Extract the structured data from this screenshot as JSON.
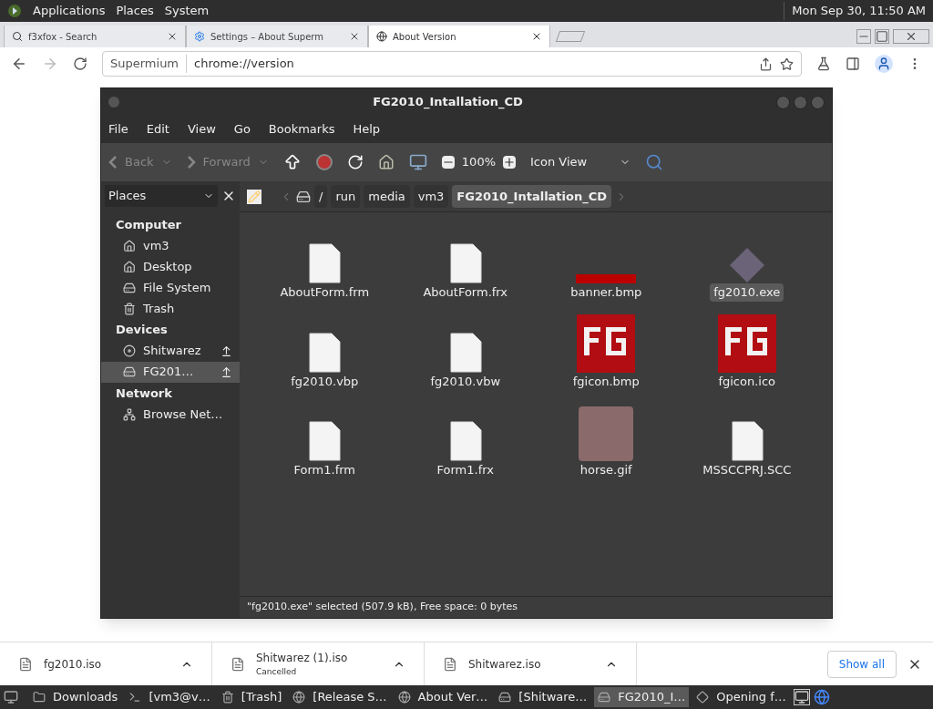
{
  "top_panel": {
    "menus": [
      "Applications",
      "Places",
      "System"
    ],
    "clock": "Mon Sep 30, 11:50 AM"
  },
  "browser": {
    "tabs": [
      {
        "title": "f3xfox - Search",
        "selected": false
      },
      {
        "title": "Settings – About Superm",
        "selected": false
      },
      {
        "title": "About Version",
        "selected": true
      }
    ],
    "address": {
      "site": "Supermium",
      "url": "chrome://version"
    }
  },
  "file_manager": {
    "title": "FG2010_Intallation_CD",
    "menu": [
      "File",
      "Edit",
      "View",
      "Go",
      "Bookmarks",
      "Help"
    ],
    "toolbar": {
      "back": "Back",
      "forward": "Forward",
      "zoom": "100%",
      "view": "Icon View"
    },
    "sidebar": {
      "selector": "Places",
      "sections": [
        {
          "heading": "Computer",
          "items": [
            {
              "label": "vm3",
              "eject": false,
              "selected": false
            },
            {
              "label": "Desktop",
              "eject": false,
              "selected": false
            },
            {
              "label": "File System",
              "eject": false,
              "selected": false
            },
            {
              "label": "Trash",
              "eject": false,
              "selected": false
            }
          ]
        },
        {
          "heading": "Devices",
          "items": [
            {
              "label": "Shitwarez",
              "eject": true,
              "selected": false
            },
            {
              "label": "FG201…",
              "eject": true,
              "selected": true
            }
          ]
        },
        {
          "heading": "Network",
          "items": [
            {
              "label": "Browse Net…",
              "eject": false,
              "selected": false
            }
          ]
        }
      ]
    },
    "path": [
      {
        "label": "/",
        "selected": false
      },
      {
        "label": "run",
        "selected": false
      },
      {
        "label": "media",
        "selected": false
      },
      {
        "label": "vm3",
        "selected": false
      },
      {
        "label": "FG2010_Intallation_CD",
        "selected": true
      }
    ],
    "files": [
      {
        "name": "AboutForm.frm",
        "kind": "doc",
        "selected": false
      },
      {
        "name": "AboutForm.frx",
        "kind": "doc",
        "selected": false
      },
      {
        "name": "banner.bmp",
        "kind": "banner",
        "selected": false
      },
      {
        "name": "fg2010.exe",
        "kind": "exe",
        "selected": true
      },
      {
        "name": "fg2010.vbp",
        "kind": "doc",
        "selected": false
      },
      {
        "name": "fg2010.vbw",
        "kind": "doc",
        "selected": false
      },
      {
        "name": "fgicon.bmp",
        "kind": "fg",
        "selected": false
      },
      {
        "name": "fgicon.ico",
        "kind": "fg",
        "selected": false
      },
      {
        "name": "Form1.frm",
        "kind": "doc",
        "selected": false
      },
      {
        "name": "Form1.frx",
        "kind": "doc",
        "selected": false
      },
      {
        "name": "horse.gif",
        "kind": "picture",
        "selected": false
      },
      {
        "name": "MSSCCPRJ.SCC",
        "kind": "doc",
        "selected": false
      }
    ],
    "status": "\"fg2010.exe\" selected (507.9 kB), Free space: 0 bytes"
  },
  "downloads": {
    "items": [
      {
        "name": "fg2010.iso"
      },
      {
        "name": "Shitwarez (1).iso",
        "note": "Cancelled"
      },
      {
        "name": "Shitwarez.iso"
      }
    ],
    "show_all": "Show all"
  },
  "taskbar": [
    {
      "label": "Downloads",
      "selected": false
    },
    {
      "label": "[vm3@v…",
      "selected": false
    },
    {
      "label": "[Trash]",
      "selected": false
    },
    {
      "label": "[Release S…",
      "selected": false
    },
    {
      "label": "About Ver…",
      "selected": false
    },
    {
      "label": "[Shitware…",
      "selected": false
    },
    {
      "label": "FG2010_I…",
      "selected": true
    },
    {
      "label": "Opening f…",
      "selected": false
    }
  ]
}
